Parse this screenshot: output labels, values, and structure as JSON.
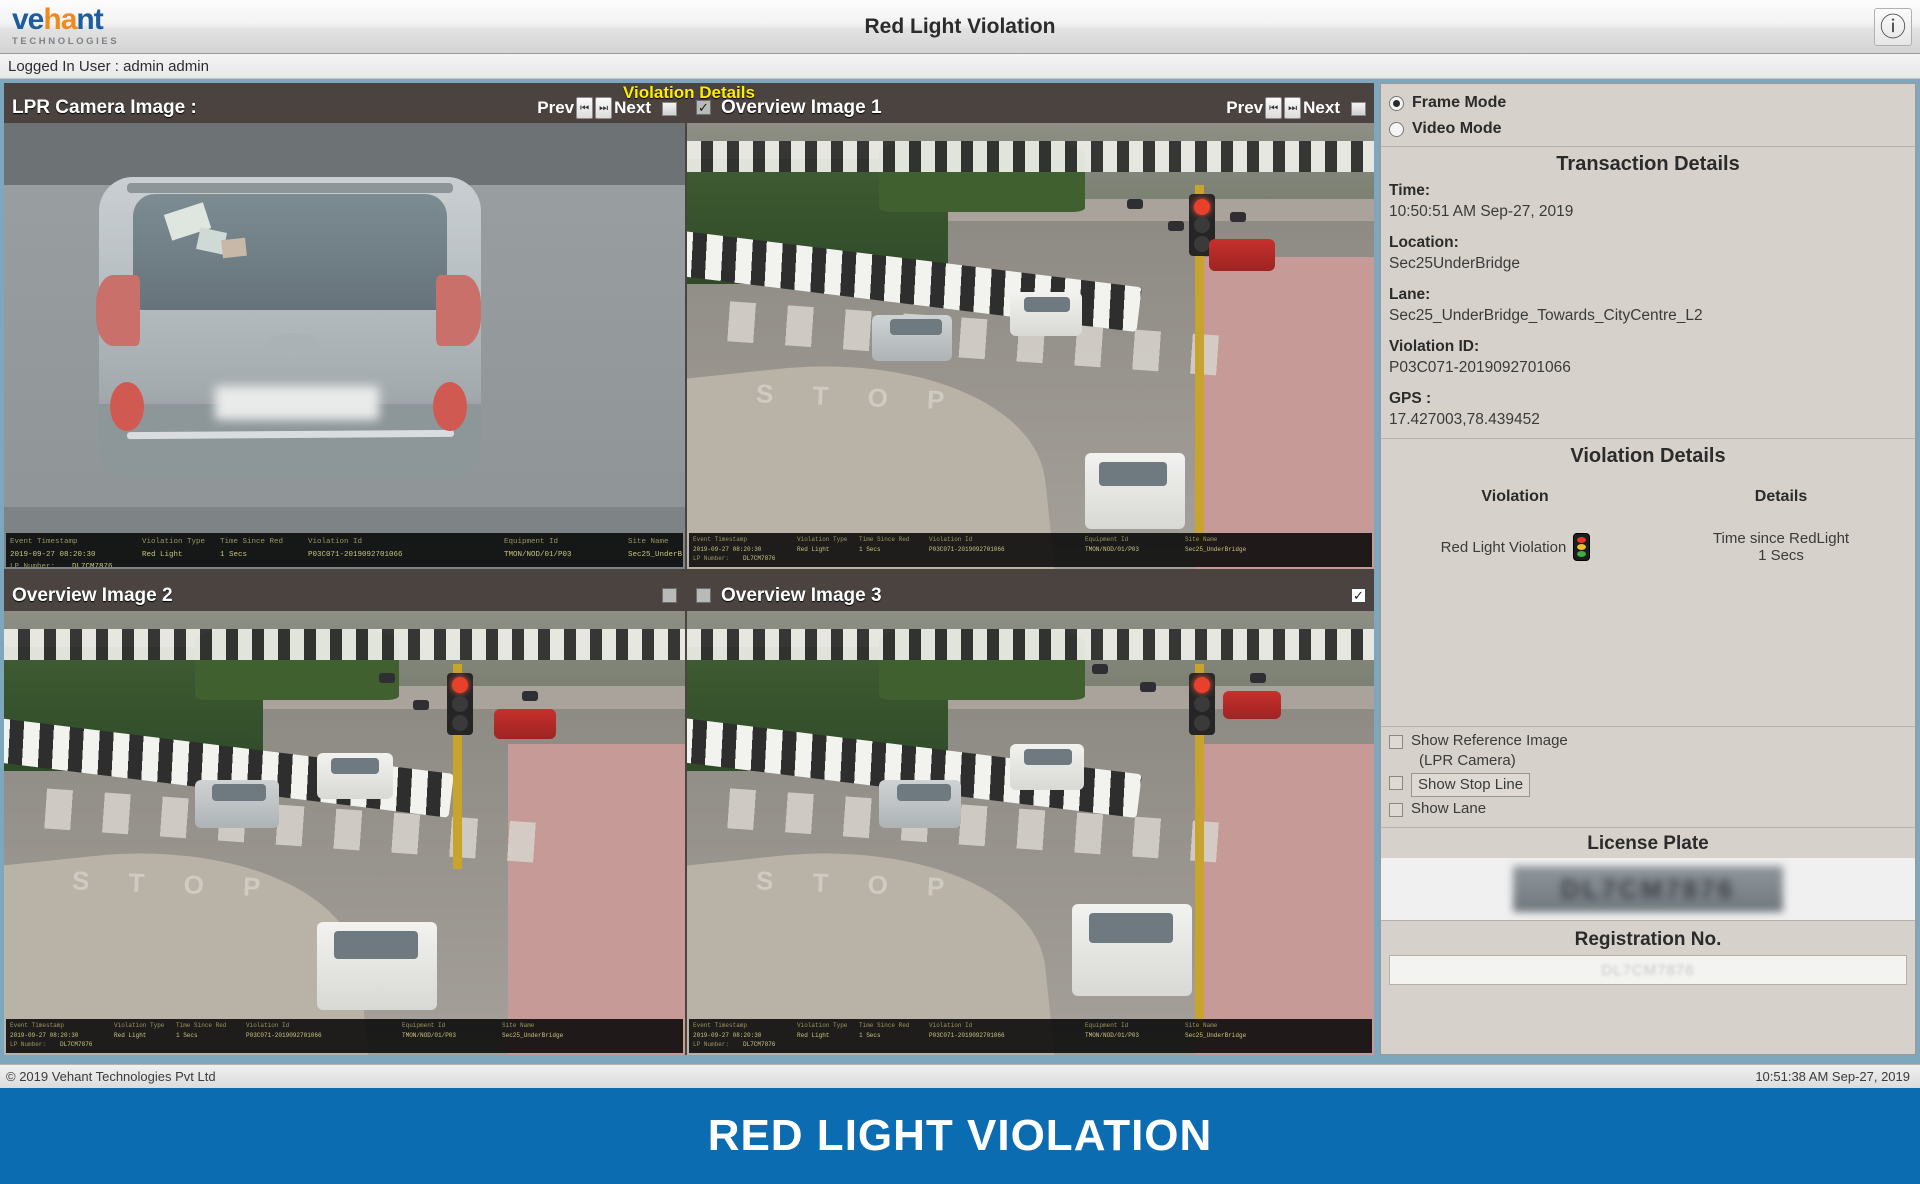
{
  "window": {
    "title": "Red Light Violation",
    "close_icon": "close-icon",
    "logo": {
      "part1": "ve",
      "part2": "ha",
      "part3": "nt",
      "subtitle": "TECHNOLOGIES"
    },
    "user_bar": "Logged In User : admin admin"
  },
  "violation_banner": "Violation Details",
  "panels": {
    "lpr": {
      "title": "LPR Camera Image :",
      "prev_label": "Prev",
      "next_label": "Next",
      "prev_icon": "skip-back-icon",
      "next_icon": "skip-forward-icon"
    },
    "overview1": {
      "title": "Overview Image 1",
      "checkbox_checked": true,
      "prev_label": "Prev",
      "next_label": "Next"
    },
    "overview2": {
      "title": "Overview Image 2",
      "checkbox_checked": false
    },
    "overview3": {
      "title": "Overview Image 3",
      "checkbox_checked": true
    }
  },
  "overlay_meta": {
    "headers": [
      "Event Timestamp",
      "Violation Type",
      "Time Since Red",
      "Violation Id",
      "Equipment Id",
      "Site Name"
    ],
    "values": [
      "2019-09-27 08:20:30",
      "Red Light",
      "1 Secs",
      "P03C071-2019092701066",
      "TMON/NOD/01/P03",
      "Sec25_UnderBridge"
    ],
    "lp_label": "LP Number:",
    "lp_value": "DL7CM7876"
  },
  "right_panel": {
    "mode": {
      "frame_label": "Frame Mode",
      "video_label": "Video Mode",
      "selected": "Frame Mode"
    },
    "transaction": {
      "title": "Transaction Details",
      "fields": [
        {
          "key": "Time:",
          "value": "10:50:51 AM   Sep-27, 2019"
        },
        {
          "key": "Location:",
          "value": "Sec25UnderBridge"
        },
        {
          "key": "Lane:",
          "value": "Sec25_UnderBridge_Towards_CityCentre_L2"
        },
        {
          "key": "Violation ID:",
          "value": "P03C071-2019092701066"
        },
        {
          "key": "GPS :",
          "value": "17.427003,78.439452"
        }
      ]
    },
    "violation": {
      "title": "Violation Details",
      "col_violation": "Violation",
      "col_details": "Details",
      "row_violation": "Red Light Violation",
      "row_icon": "traffic-light-icon",
      "row_detail_line1": "Time since RedLight",
      "row_detail_line2": "1 Secs"
    },
    "options": {
      "show_reference_line1": "Show Reference Image",
      "show_reference_line2": "(LPR Camera)",
      "show_stop_line": "Show Stop Line",
      "show_lane": "Show Lane"
    },
    "license_plate": {
      "title": "License Plate",
      "plate_value": "DL7CM7876"
    },
    "registration": {
      "title": "Registration No.",
      "value": "DL7CM7876"
    }
  },
  "status_bar": {
    "copyright": "© 2019 Vehant Technologies Pvt Ltd",
    "datetime": "10:51:38 AM   Sep-27, 2019"
  },
  "bottom_banner": "RED LIGHT VIOLATION",
  "colors": {
    "banner_blue": "#0b6cb2",
    "accent_yellow": "#ffee00",
    "panel_bg": "#d6d2cb",
    "workarea_blue": "#7ea6bd"
  }
}
